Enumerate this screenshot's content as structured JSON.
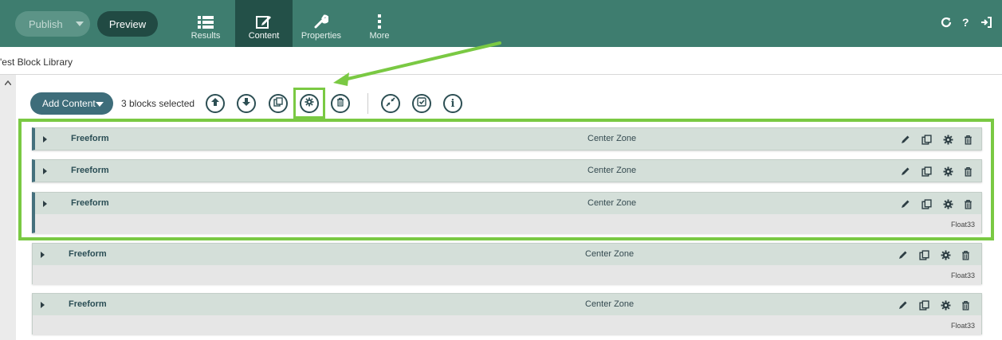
{
  "topbar": {
    "publish_label": "Publish",
    "preview_label": "Preview",
    "tabs": [
      {
        "label": "Results",
        "icon": "list-icon"
      },
      {
        "label": "Content",
        "icon": "edit-icon"
      },
      {
        "label": "Properties",
        "icon": "wrench-icon"
      },
      {
        "label": "More",
        "icon": "vertical-dots-icon"
      }
    ],
    "right_icons": [
      "refresh-icon",
      "help-icon",
      "sign-out-icon"
    ],
    "help_glyph": "?"
  },
  "breadcrumb": "'est Block Library",
  "toolbar": {
    "add_content_label": "Add Content",
    "selection_text": "3 blocks selected",
    "info_glyph": "i",
    "buttons": [
      "move-up-icon",
      "move-down-icon",
      "copy-icon",
      "gear-icon",
      "delete-icon",
      "collapse-icon",
      "checklist-icon",
      "info-icon"
    ]
  },
  "blocks": [
    {
      "title": "Freeform",
      "zone": "Center Zone",
      "selected": true,
      "float": ""
    },
    {
      "title": "Freeform",
      "zone": "Center Zone",
      "selected": true,
      "float": ""
    },
    {
      "title": "Freeform",
      "zone": "Center Zone",
      "selected": true,
      "float": "Float33"
    },
    {
      "title": "Freeform",
      "zone": "Center Zone",
      "selected": false,
      "float": "Float33"
    },
    {
      "title": "Freeform",
      "zone": "Center Zone",
      "selected": false,
      "float": "Float33"
    }
  ],
  "colors": {
    "header": "#3e7d6f",
    "active_tab": "#235048",
    "highlight": "#7ac943",
    "row_bg": "#d4dfd9",
    "row_accent": "#45707d"
  }
}
